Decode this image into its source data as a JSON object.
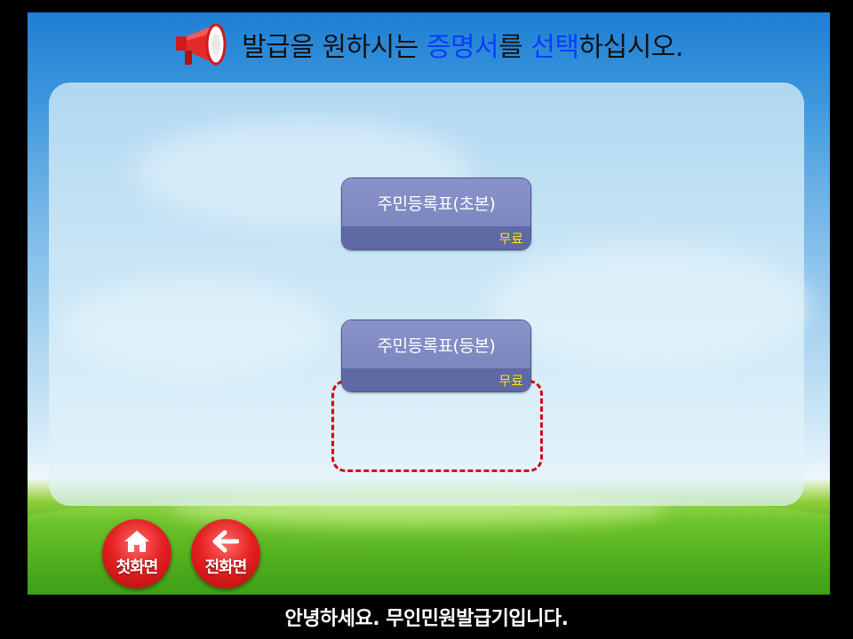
{
  "header": {
    "title_part1": "발급을 원하시는 ",
    "title_highlight1": "증명서",
    "title_part2": "를 ",
    "title_highlight2": "선택",
    "title_part3": "하십시오.",
    "icon": "megaphone-icon"
  },
  "certificates": [
    {
      "label": "주민등록표(초본)",
      "fee": "무료"
    },
    {
      "label": "주민등록표(등본)",
      "fee": "무료",
      "highlighted": true
    }
  ],
  "nav": {
    "home_label": "첫화면",
    "home_icon": "home-icon",
    "back_label": "전화면",
    "back_icon": "arrow-left-icon"
  },
  "footer": {
    "message": "안녕하세요. 무인민원발급기입니다."
  },
  "colors": {
    "highlight_text": "#0a3dff",
    "fee_text": "#ffe600",
    "selection_border": "#d7000f",
    "nav_button": "#e62222"
  }
}
